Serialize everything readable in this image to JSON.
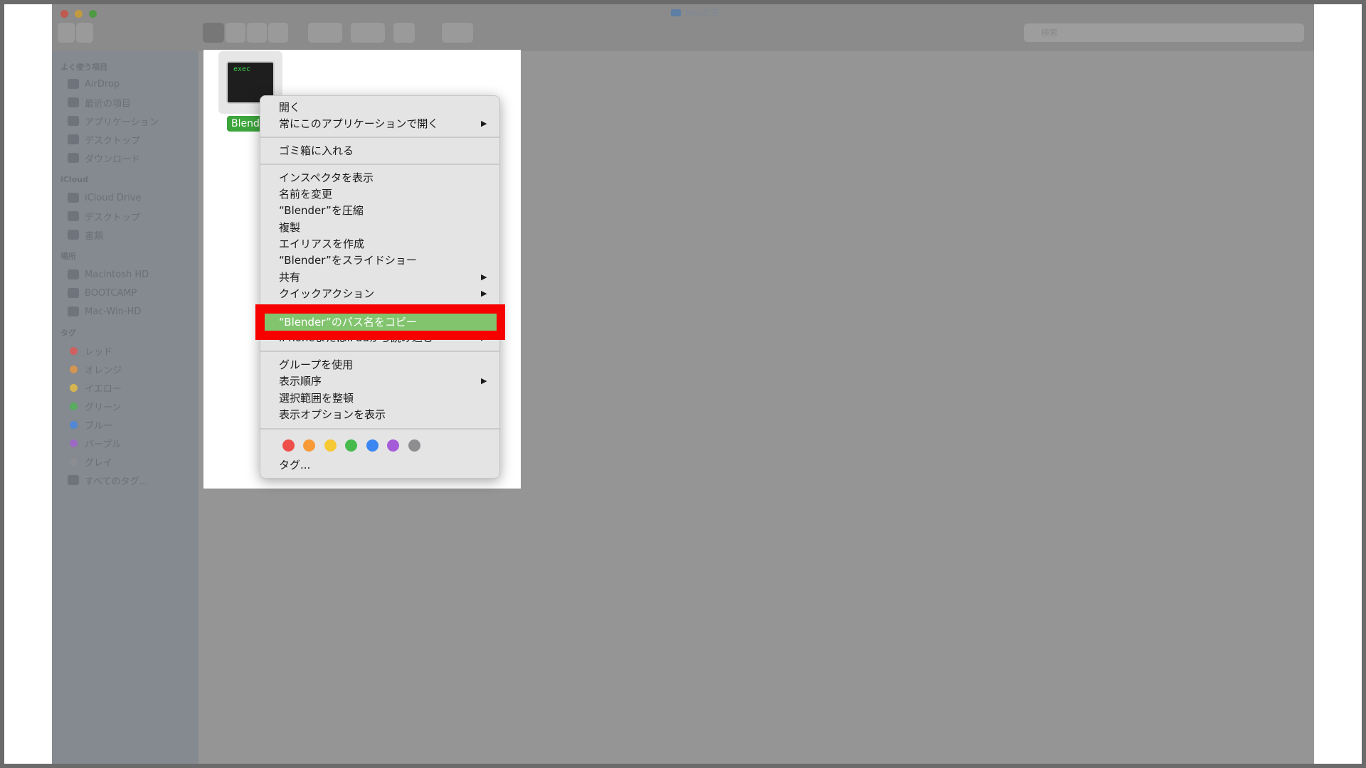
{
  "window": {
    "title": "Macの王",
    "traffic_lights": {
      "close": "#c0594f",
      "minimize": "#c29a3e",
      "zoom": "#4f9a44"
    },
    "search_placeholder": "検索"
  },
  "sidebar": {
    "sections": [
      {
        "label": "よく使う項目",
        "items": [
          "AirDrop",
          "最近の項目",
          "アプリケーション",
          "デスクトップ",
          "ダウンロード"
        ]
      },
      {
        "label": "iCloud",
        "items": [
          "iCloud Drive",
          "デスクトップ",
          "書類"
        ]
      },
      {
        "label": "場所",
        "items": [
          "Macintosh HD",
          "BOOTCAMP",
          "Mac-Win-HD"
        ]
      },
      {
        "label": "タグ",
        "items": [
          "レッド",
          "オレンジ",
          "イエロー",
          "グリーン",
          "ブルー",
          "パープル",
          "グレイ",
          "すべてのタグ..."
        ]
      }
    ]
  },
  "file": {
    "name": "Blende",
    "icon_text": "exec",
    "icon": "terminal-exec-icon"
  },
  "context_menu": {
    "open": "開く",
    "always_open_with": "常にこのアプリケーションで開く",
    "move_to_trash": "ゴミ箱に入れる",
    "show_inspector": "インスペクタを表示",
    "rename": "名前を変更",
    "compress": "“Blender”を圧縮",
    "duplicate": "複製",
    "make_alias": "エイリアスを作成",
    "slideshow": "“Blender”をスライドショー",
    "share": "共有",
    "quick_actions": "クイックアクション",
    "copy_path": "“Blender”のパス名をコピー",
    "import_iphone": "iPhoneまたはiPadから読み込む",
    "use_groups": "グループを使用",
    "sort_by": "表示順序",
    "clean_up": "選択範囲を整頓",
    "view_options": "表示オプションを表示",
    "tags": "タグ...",
    "submenu_arrow": "▶",
    "tag_colors": [
      "#ee4f4a",
      "#f79a38",
      "#f6c833",
      "#46bb4c",
      "#3b86f2",
      "#a65bd8",
      "#8e8e90"
    ]
  },
  "highlight_color": "#f60000"
}
